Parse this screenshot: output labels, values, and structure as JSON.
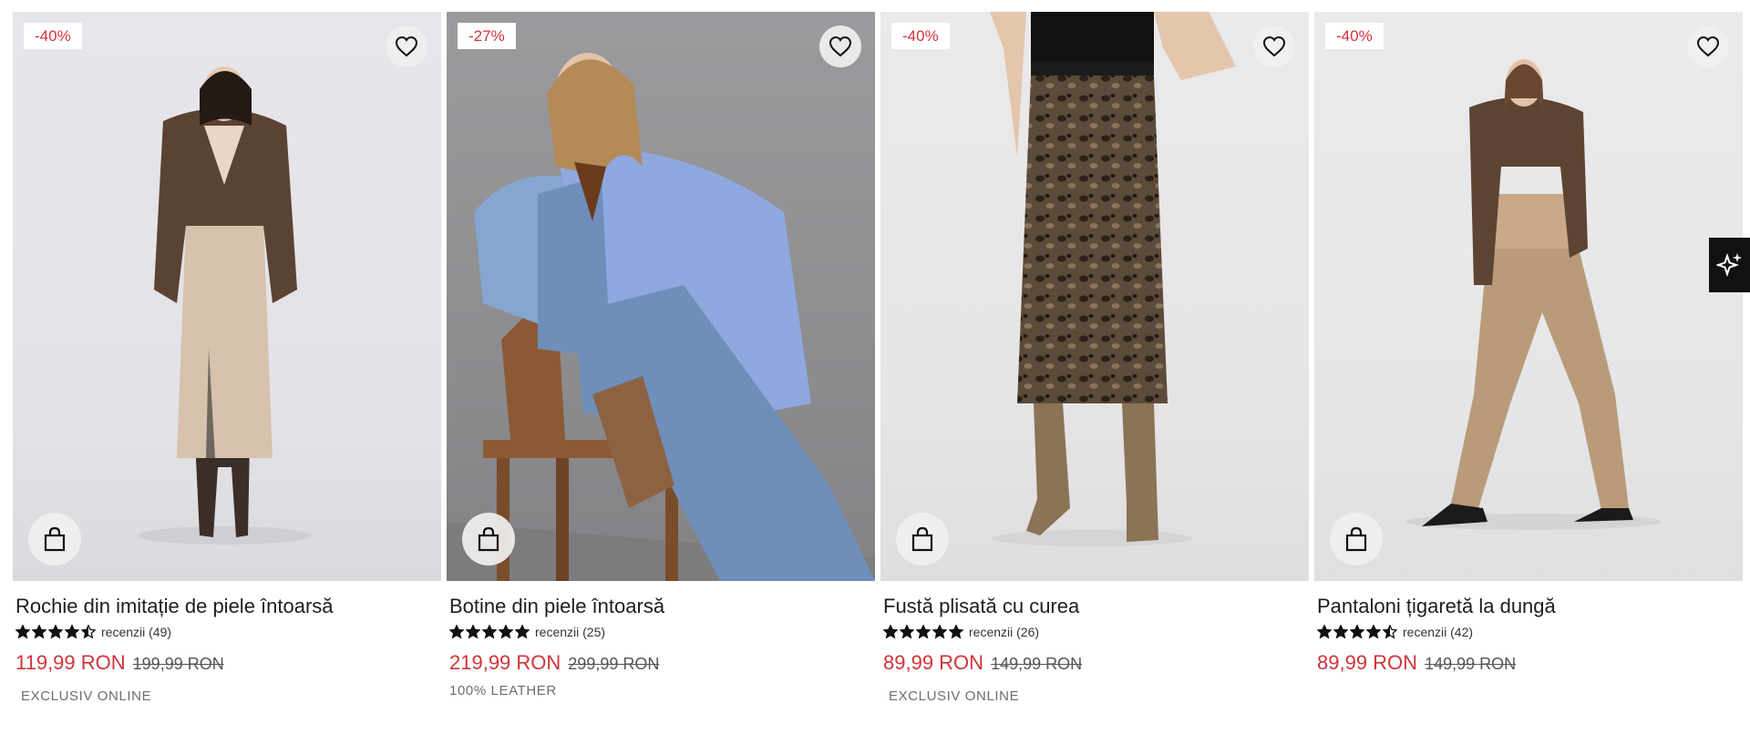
{
  "products": [
    {
      "discount": "-40%",
      "title": "Rochie din imitație de piele întoarsă",
      "rating_value": 4.5,
      "reviews": "recenzii (49)",
      "price": "119,99 RON",
      "old_price": "199,99 RON",
      "tag": "EXCLUSIV ONLINE"
    },
    {
      "discount": "-27%",
      "title": "Botine din piele întoarsă",
      "rating_value": 5,
      "reviews": "recenzii (25)",
      "price": "219,99 RON",
      "old_price": "299,99 RON",
      "tag": "100% LEATHER"
    },
    {
      "discount": "-40%",
      "title": "Fustă plisată cu curea",
      "rating_value": 5,
      "reviews": "recenzii (26)",
      "price": "89,99 RON",
      "old_price": "149,99 RON",
      "tag": "EXCLUSIV ONLINE"
    },
    {
      "discount": "-40%",
      "title": "Pantaloni țigaretă la dungă",
      "rating_value": 4.5,
      "reviews": "recenzii (42)",
      "price": "89,99 RON",
      "old_price": "149,99 RON",
      "tag": ""
    }
  ],
  "icons": {
    "wishlist": "heart-icon",
    "cart": "shopping-bag-icon",
    "star": "star-icon",
    "ai": "sparkles-icon"
  },
  "colors": {
    "sale_red": "#d2333a",
    "text": "#1e1e1e",
    "muted": "#6d6d6d"
  }
}
